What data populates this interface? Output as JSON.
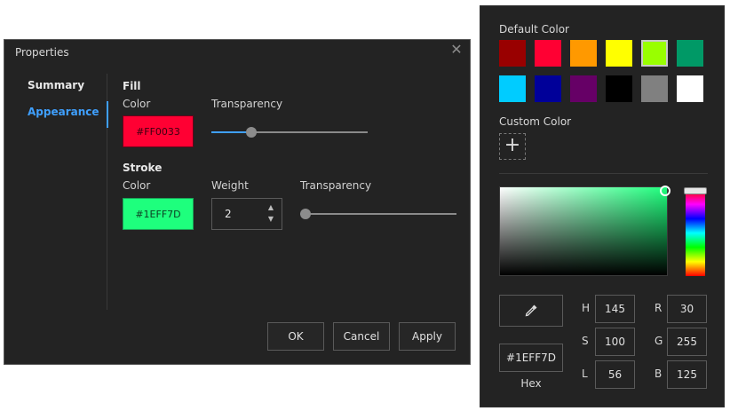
{
  "dialog": {
    "title": "Properties",
    "close_icon": "close-icon",
    "nav": {
      "summary": "Summary",
      "appearance": "Appearance"
    },
    "fill": {
      "heading": "Fill",
      "color_label": "Color",
      "color_value": "#FF0033",
      "transparency_label": "Transparency",
      "transparency_level": 0.24
    },
    "stroke": {
      "heading": "Stroke",
      "color_label": "Color",
      "color_value": "#1EFF7D",
      "weight_label": "Weight",
      "weight_value": "2",
      "transparency_label": "Transparency",
      "transparency_level": 0.0
    },
    "buttons": {
      "ok": "OK",
      "cancel": "Cancel",
      "apply": "Apply"
    }
  },
  "picker": {
    "default_color_label": "Default Color",
    "default_colors": [
      "#990000",
      "#FF0033",
      "#FF9900",
      "#FFFF00",
      "#99FF00",
      "#009966",
      "#00CCFF",
      "#000099",
      "#660066",
      "#000000",
      "#808080",
      "#FFFFFF"
    ],
    "selected_default": "#99FF00",
    "custom_color_label": "Custom Color",
    "add_icon": "plus-icon",
    "eyedropper_icon": "eyedropper-icon",
    "hex_value": "#1EFF7D",
    "hex_label": "Hex",
    "h_label": "H",
    "h_value": "145",
    "s_label": "S",
    "s_value": "100",
    "l_label": "L",
    "l_value": "56",
    "r_label": "R",
    "r_value": "30",
    "g_label": "G",
    "g_value": "255",
    "b_label": "B",
    "b_value": "125"
  }
}
